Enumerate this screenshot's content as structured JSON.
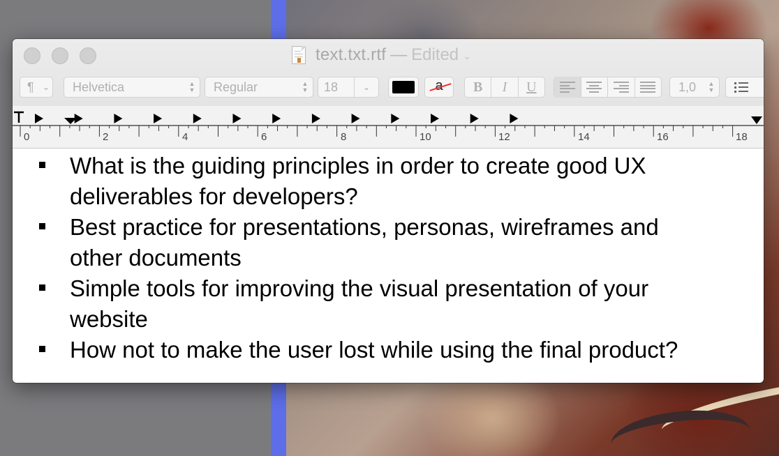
{
  "window": {
    "filename": "text.txt.rtf",
    "separator": "—",
    "status": "Edited"
  },
  "toolbar": {
    "paragraph_symbol": "¶",
    "font_family": "Helvetica",
    "font_style": "Regular",
    "font_size": "18",
    "text_color": "#000000",
    "highlight_label": "a",
    "bold_label": "B",
    "italic_label": "I",
    "underline_label": "U",
    "line_spacing": "1,0",
    "active_alignment": "left"
  },
  "ruler": {
    "labels": [
      "0",
      "2",
      "4",
      "6",
      "8",
      "10",
      "12",
      "14",
      "16",
      "18"
    ]
  },
  "document": {
    "items": [
      {
        "lines": [
          "What is the guiding principles in order to create good UX",
          "deliverables for developers?"
        ]
      },
      {
        "lines": [
          "Best practice for presentations, personas, wireframes and",
          "other documents"
        ]
      },
      {
        "lines": [
          "Simple tools for improving the visual presentation of your",
          "website"
        ]
      },
      {
        "lines": [
          "How not to make the user lost while using the final product?"
        ]
      }
    ]
  },
  "colors": {
    "desktop_blue": "#5d6ee8",
    "traffic_light_inactive": "#d0d0d0"
  }
}
